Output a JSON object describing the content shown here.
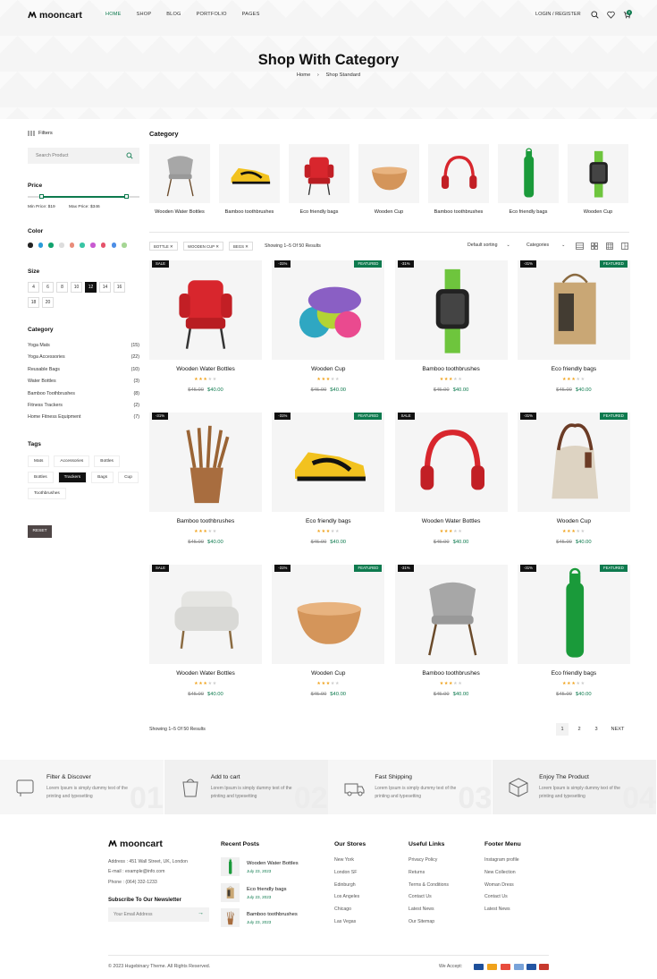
{
  "header": {
    "logo": "mooncart",
    "nav": [
      "HOME",
      "SHOP",
      "BLOG",
      "PORTFOLIO",
      "PAGES"
    ],
    "login": "LOGIN / REGISTER",
    "cart_count": "0"
  },
  "hero": {
    "title": "Shop With Category",
    "breadcrumb_home": "Home",
    "breadcrumb_current": "Shop Standard"
  },
  "sidebar": {
    "filters": "Filters",
    "search_placeholder": "Search Product",
    "price_title": "Price",
    "min_price": "Min Price: $19",
    "max_price": "Max Price: $346",
    "color_title": "Color",
    "colors": [
      "#222222",
      "#2a9bd8",
      "#12a36e",
      "#dddddd",
      "#e98c7a",
      "#39c5a4",
      "#c85ad1",
      "#e5536b",
      "#4d8ee6",
      "#a5d694"
    ],
    "size_title": "Size",
    "sizes": [
      "4",
      "6",
      "8",
      "10",
      "12",
      "14",
      "16",
      "18",
      "20"
    ],
    "size_active": "12",
    "category_title": "Category",
    "categories": [
      {
        "name": "Yoga Mats",
        "count": "(15)"
      },
      {
        "name": "Yoga Accessories",
        "count": "(22)"
      },
      {
        "name": "Reusable Bags",
        "count": "(10)"
      },
      {
        "name": "Water Bottles",
        "count": "(3)"
      },
      {
        "name": "Bamboo Toothbrushes",
        "count": "(8)"
      },
      {
        "name": "Fitness Trackers",
        "count": "(2)"
      },
      {
        "name": "Home Fitness Equipment",
        "count": "(7)"
      }
    ],
    "tags_title": "Tags",
    "tags": [
      "Mats",
      "Accessories",
      "Bottles",
      "Bottles",
      "Trackers",
      "Bags",
      "Cup",
      "Toothbrushes"
    ],
    "tag_active": "Trackers",
    "reset": "RESET"
  },
  "category_strip": {
    "title": "Category",
    "items": [
      "Wooden Water Bottles",
      "Bamboo toothbrushes",
      "Eco friendly bags",
      "Wooden Cup",
      "Bamboo toothbrushes",
      "Eco friendly bags",
      "Wooden Cup"
    ]
  },
  "toolbar": {
    "chips": [
      "BOTTLE",
      "WOODEN CUP",
      "BEGS"
    ],
    "results": "Showing 1–5 Of 50 Results",
    "sort": "Default sorting",
    "categories": "Categories"
  },
  "products": [
    {
      "name": "Wooden Water Bottles",
      "left": "SALE",
      "right": "",
      "old": "$45.00",
      "new": "$40.00",
      "stars": 3
    },
    {
      "name": "Wooden Cup",
      "left": "-31%",
      "right": "FEATURED",
      "old": "$45.00",
      "new": "$40.00",
      "stars": 3
    },
    {
      "name": "Bamboo toothbrushes",
      "left": "-31%",
      "right": "",
      "old": "$45.00",
      "new": "$40.00",
      "stars": 3
    },
    {
      "name": "Eco friendly bags",
      "left": "-31%",
      "right": "FEATURED",
      "old": "$45.00",
      "new": "$40.00",
      "stars": 3
    },
    {
      "name": "Bamboo toothbrushes",
      "left": "-31%",
      "right": "",
      "old": "$45.00",
      "new": "$40.00",
      "stars": 3
    },
    {
      "name": "Eco friendly bags",
      "left": "-31%",
      "right": "FEATURED",
      "old": "$45.00",
      "new": "$40.00",
      "stars": 3
    },
    {
      "name": "Wooden Water Bottles",
      "left": "SALE",
      "right": "",
      "old": "$45.00",
      "new": "$40.00",
      "stars": 3
    },
    {
      "name": "Wooden Cup",
      "left": "-31%",
      "right": "FEATURED",
      "old": "$45.00",
      "new": "$40.00",
      "stars": 3
    },
    {
      "name": "Wooden Water Bottles",
      "left": "SALE",
      "right": "",
      "old": "$45.00",
      "new": "$40.00",
      "stars": 3
    },
    {
      "name": "Wooden Cup",
      "left": "-31%",
      "right": "FEATURED",
      "old": "$45.00",
      "new": "$40.00",
      "stars": 3
    },
    {
      "name": "Bamboo toothbrushes",
      "left": "-31%",
      "right": "",
      "old": "$45.00",
      "new": "$40.00",
      "stars": 3
    },
    {
      "name": "Eco friendly bags",
      "left": "-31%",
      "right": "FEATURED",
      "old": "$45.00",
      "new": "$40.00",
      "stars": 3
    }
  ],
  "pagination": {
    "results": "Showing 1–5 Of 50 Results",
    "pages": [
      "1",
      "2",
      "3"
    ],
    "next": "NEXT"
  },
  "features": [
    {
      "title": "Filter & Discover",
      "desc": "Lorem Ipsum is simply dummy text of the printing and typesetting",
      "num": "01"
    },
    {
      "title": "Add to cart",
      "desc": "Lorem Ipsum is simply dummy text of the printing and typesetting",
      "num": "02"
    },
    {
      "title": "Fast Shipping",
      "desc": "Lorem Ipsum is simply dummy text of the printing and typesetting",
      "num": "03"
    },
    {
      "title": "Enjoy The Product",
      "desc": "Lorem Ipsum is simply dummy text of the printing and typesetting",
      "num": "04"
    }
  ],
  "footer": {
    "logo": "mooncart",
    "address": "Address : 451 Wall Street, UK, London",
    "email": "E-mail : example@info.com",
    "phone": "Phone : (064) 332-1233",
    "newsletter": "Subscribe To Our Newsletter",
    "email_placeholder": "Your Email Address",
    "recent_title": "Recent Posts",
    "posts": [
      {
        "title": "Wooden Water Bottles",
        "date": "July 23, 2023"
      },
      {
        "title": "Eco friendly bags",
        "date": "July 23, 2023"
      },
      {
        "title": "Bamboo toothbrushes",
        "date": "July 23, 2023"
      }
    ],
    "stores_title": "Our Stores",
    "stores": [
      "New York",
      "London SF",
      "Edinburgh",
      "Los Angeles",
      "Chicago",
      "Las Vegas"
    ],
    "links_title": "Useful Links",
    "links": [
      "Privacy Policy",
      "Returns",
      "Terms & Conditions",
      "Contact Us",
      "Latest News",
      "Our Sitemap"
    ],
    "menu_title": "Footer Menu",
    "menu": [
      "Instagram profile",
      "New Collection",
      "Woman Dress",
      "Contact Us",
      "Latest News"
    ],
    "copyright": "© 2023 Hugebinary Theme. All Rights Reserved.",
    "we_accept": "We Accept:"
  }
}
